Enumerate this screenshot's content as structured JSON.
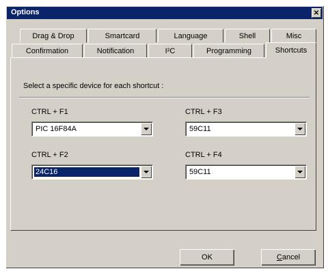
{
  "window": {
    "title": "Options",
    "close_glyph": "✕"
  },
  "tabs_back": [
    {
      "label": "Drag & Drop"
    },
    {
      "label": "Smartcard"
    },
    {
      "label": "Language"
    },
    {
      "label": "Shell"
    },
    {
      "label": "Misc"
    }
  ],
  "tabs_front": [
    {
      "label": "Confirmation"
    },
    {
      "label": "Notification"
    },
    {
      "label": "I²C"
    },
    {
      "label": "Programming"
    },
    {
      "label": "Shortcuts",
      "active": true
    }
  ],
  "panel": {
    "instruction": "Select a specific device for each shortcut :",
    "shortcuts": [
      {
        "label": "CTRL + F1",
        "value": "PIC 16F84A",
        "selected": false
      },
      {
        "label": "CTRL + F3",
        "value": "59C11",
        "selected": false
      },
      {
        "label": "CTRL + F2",
        "value": "24C16",
        "selected": true
      },
      {
        "label": "CTRL + F4",
        "value": "59C11",
        "selected": false
      }
    ]
  },
  "buttons": {
    "ok": "OK",
    "cancel_first": "C",
    "cancel_rest": "ancel"
  },
  "colors": {
    "face": "#d4d0c8",
    "title": "#0a246a",
    "selection": "#0a246a"
  }
}
